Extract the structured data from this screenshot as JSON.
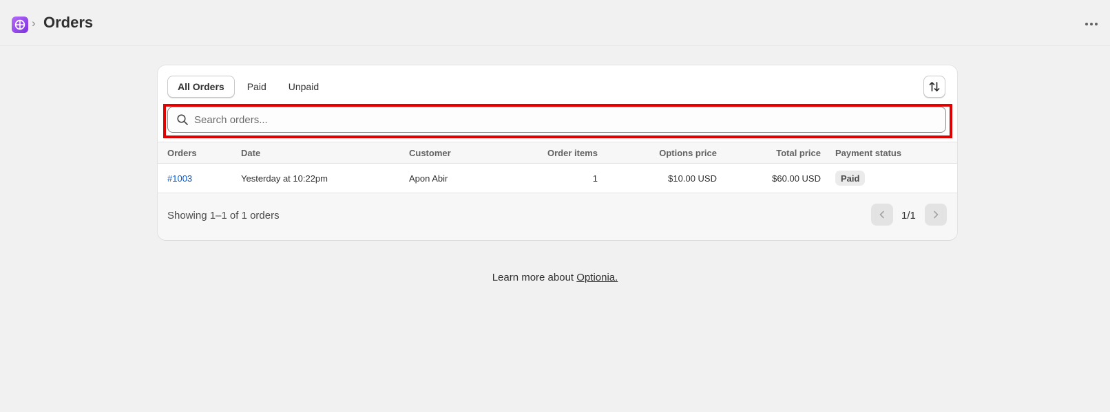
{
  "header": {
    "app_icon": "optionia-logo-icon",
    "breadcrumb_separator": "›",
    "title": "Orders",
    "more_icon": "more-horizontal-icon"
  },
  "tabs": [
    {
      "label": "All Orders",
      "active": true
    },
    {
      "label": "Paid",
      "active": false
    },
    {
      "label": "Unpaid",
      "active": false
    }
  ],
  "sort_icon": "sort-arrows-icon",
  "search": {
    "placeholder": "Search orders...",
    "value": "",
    "icon": "search-icon"
  },
  "table": {
    "columns": [
      "Orders",
      "Date",
      "Customer",
      "Order items",
      "Options price",
      "Total price",
      "Payment status"
    ],
    "rows": [
      {
        "order": "#1003",
        "date": "Yesterday at 10:22pm",
        "customer": "Apon Abir",
        "items": "1",
        "options_price": "$10.00 USD",
        "total_price": "$60.00 USD",
        "payment_status": "Paid"
      }
    ]
  },
  "pagination": {
    "showing": "Showing 1–1 of 1 orders",
    "page": "1/1"
  },
  "footer": {
    "learn_prefix": "Learn more about ",
    "learn_link": "Optionia."
  },
  "colors": {
    "background": "#f1f1f1",
    "link": "#005bd3",
    "highlight": "#e00000",
    "app_icon": "#9b4ef0"
  }
}
